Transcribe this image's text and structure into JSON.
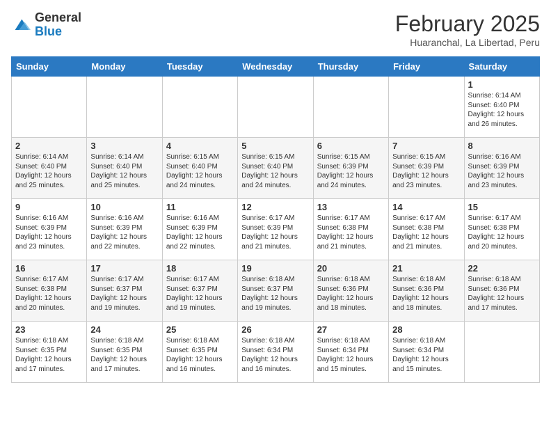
{
  "header": {
    "logo_general": "General",
    "logo_blue": "Blue",
    "title": "February 2025",
    "subtitle": "Huaranchal, La Libertad, Peru"
  },
  "weekdays": [
    "Sunday",
    "Monday",
    "Tuesday",
    "Wednesday",
    "Thursday",
    "Friday",
    "Saturday"
  ],
  "weeks": [
    [
      {
        "day": "",
        "info": ""
      },
      {
        "day": "",
        "info": ""
      },
      {
        "day": "",
        "info": ""
      },
      {
        "day": "",
        "info": ""
      },
      {
        "day": "",
        "info": ""
      },
      {
        "day": "",
        "info": ""
      },
      {
        "day": "1",
        "info": "Sunrise: 6:14 AM\nSunset: 6:40 PM\nDaylight: 12 hours\nand 26 minutes."
      }
    ],
    [
      {
        "day": "2",
        "info": "Sunrise: 6:14 AM\nSunset: 6:40 PM\nDaylight: 12 hours\nand 25 minutes."
      },
      {
        "day": "3",
        "info": "Sunrise: 6:14 AM\nSunset: 6:40 PM\nDaylight: 12 hours\nand 25 minutes."
      },
      {
        "day": "4",
        "info": "Sunrise: 6:15 AM\nSunset: 6:40 PM\nDaylight: 12 hours\nand 24 minutes."
      },
      {
        "day": "5",
        "info": "Sunrise: 6:15 AM\nSunset: 6:40 PM\nDaylight: 12 hours\nand 24 minutes."
      },
      {
        "day": "6",
        "info": "Sunrise: 6:15 AM\nSunset: 6:39 PM\nDaylight: 12 hours\nand 24 minutes."
      },
      {
        "day": "7",
        "info": "Sunrise: 6:15 AM\nSunset: 6:39 PM\nDaylight: 12 hours\nand 23 minutes."
      },
      {
        "day": "8",
        "info": "Sunrise: 6:16 AM\nSunset: 6:39 PM\nDaylight: 12 hours\nand 23 minutes."
      }
    ],
    [
      {
        "day": "9",
        "info": "Sunrise: 6:16 AM\nSunset: 6:39 PM\nDaylight: 12 hours\nand 23 minutes."
      },
      {
        "day": "10",
        "info": "Sunrise: 6:16 AM\nSunset: 6:39 PM\nDaylight: 12 hours\nand 22 minutes."
      },
      {
        "day": "11",
        "info": "Sunrise: 6:16 AM\nSunset: 6:39 PM\nDaylight: 12 hours\nand 22 minutes."
      },
      {
        "day": "12",
        "info": "Sunrise: 6:17 AM\nSunset: 6:39 PM\nDaylight: 12 hours\nand 21 minutes."
      },
      {
        "day": "13",
        "info": "Sunrise: 6:17 AM\nSunset: 6:38 PM\nDaylight: 12 hours\nand 21 minutes."
      },
      {
        "day": "14",
        "info": "Sunrise: 6:17 AM\nSunset: 6:38 PM\nDaylight: 12 hours\nand 21 minutes."
      },
      {
        "day": "15",
        "info": "Sunrise: 6:17 AM\nSunset: 6:38 PM\nDaylight: 12 hours\nand 20 minutes."
      }
    ],
    [
      {
        "day": "16",
        "info": "Sunrise: 6:17 AM\nSunset: 6:38 PM\nDaylight: 12 hours\nand 20 minutes."
      },
      {
        "day": "17",
        "info": "Sunrise: 6:17 AM\nSunset: 6:37 PM\nDaylight: 12 hours\nand 19 minutes."
      },
      {
        "day": "18",
        "info": "Sunrise: 6:17 AM\nSunset: 6:37 PM\nDaylight: 12 hours\nand 19 minutes."
      },
      {
        "day": "19",
        "info": "Sunrise: 6:18 AM\nSunset: 6:37 PM\nDaylight: 12 hours\nand 19 minutes."
      },
      {
        "day": "20",
        "info": "Sunrise: 6:18 AM\nSunset: 6:36 PM\nDaylight: 12 hours\nand 18 minutes."
      },
      {
        "day": "21",
        "info": "Sunrise: 6:18 AM\nSunset: 6:36 PM\nDaylight: 12 hours\nand 18 minutes."
      },
      {
        "day": "22",
        "info": "Sunrise: 6:18 AM\nSunset: 6:36 PM\nDaylight: 12 hours\nand 17 minutes."
      }
    ],
    [
      {
        "day": "23",
        "info": "Sunrise: 6:18 AM\nSunset: 6:35 PM\nDaylight: 12 hours\nand 17 minutes."
      },
      {
        "day": "24",
        "info": "Sunrise: 6:18 AM\nSunset: 6:35 PM\nDaylight: 12 hours\nand 17 minutes."
      },
      {
        "day": "25",
        "info": "Sunrise: 6:18 AM\nSunset: 6:35 PM\nDaylight: 12 hours\nand 16 minutes."
      },
      {
        "day": "26",
        "info": "Sunrise: 6:18 AM\nSunset: 6:34 PM\nDaylight: 12 hours\nand 16 minutes."
      },
      {
        "day": "27",
        "info": "Sunrise: 6:18 AM\nSunset: 6:34 PM\nDaylight: 12 hours\nand 15 minutes."
      },
      {
        "day": "28",
        "info": "Sunrise: 6:18 AM\nSunset: 6:34 PM\nDaylight: 12 hours\nand 15 minutes."
      },
      {
        "day": "",
        "info": ""
      }
    ]
  ]
}
